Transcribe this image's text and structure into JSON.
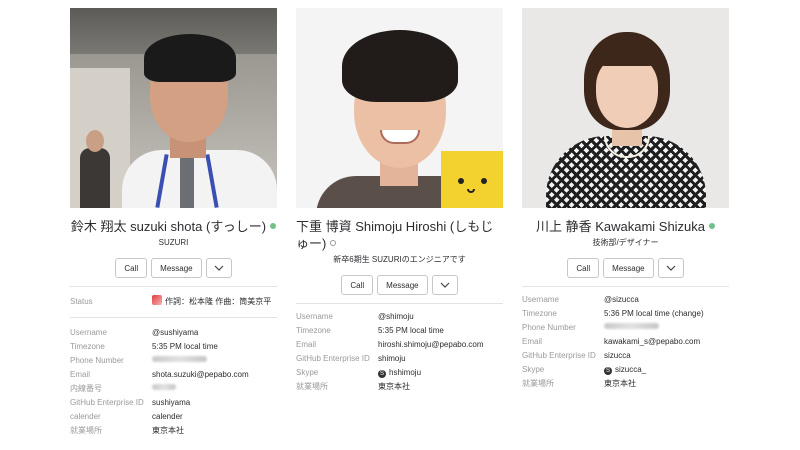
{
  "actions": {
    "call": "Call",
    "message": "Message",
    "more_icon": "chevron-down-icon"
  },
  "colors": {
    "presence_active": "#6fc188",
    "label": "#9a9a9a"
  },
  "profiles": [
    {
      "name": "鈴木 翔太 suzuki shota (すっしー)",
      "presence": "active",
      "subtitle": "SUZURI",
      "status": {
        "label": "Status",
        "value": "作詞：松本隆 作曲：筒美京平"
      },
      "fields": [
        {
          "label": "Username",
          "value": "@sushiyama"
        },
        {
          "label": "Timezone",
          "value": "5:35 PM local time"
        },
        {
          "label": "Phone Number",
          "value": ""
        },
        {
          "label": "Email",
          "value": "shota.suzuki@pepabo.com"
        },
        {
          "label": "内線番号",
          "value": ""
        },
        {
          "label": "GitHub Enterprise ID",
          "value": "sushiyama"
        },
        {
          "label": "calender",
          "value": "calender"
        },
        {
          "label": "就業場所",
          "value": "東京本社"
        }
      ]
    },
    {
      "name": "下重 博資 Shimoju Hiroshi (しもじゅー)",
      "presence": "away",
      "subtitle": "新卒6期生 SUZURIのエンジニアです",
      "fields": [
        {
          "label": "Username",
          "value": "@shimoju"
        },
        {
          "label": "Timezone",
          "value": "5:35 PM local time"
        },
        {
          "label": "Email",
          "value": "hiroshi.shimoju@pepabo.com"
        },
        {
          "label": "GitHub Enterprise ID",
          "value": "shimoju"
        },
        {
          "label": "Skype",
          "value": "hshimoju"
        },
        {
          "label": "就業場所",
          "value": "東京本社"
        }
      ]
    },
    {
      "name": "川上 静香 Kawakami Shizuka",
      "presence": "active",
      "subtitle": "技術部/デザイナー",
      "fields": [
        {
          "label": "Username",
          "value": "@sizucca"
        },
        {
          "label": "Timezone",
          "value": "5:36 PM local time (change)"
        },
        {
          "label": "Phone Number",
          "value": ""
        },
        {
          "label": "Email",
          "value": "kawakami_s@pepabo.com"
        },
        {
          "label": "GitHub Enterprise ID",
          "value": "sizucca"
        },
        {
          "label": "Skype",
          "value": "sizucca_"
        },
        {
          "label": "就業場所",
          "value": "東京本社"
        }
      ]
    }
  ]
}
